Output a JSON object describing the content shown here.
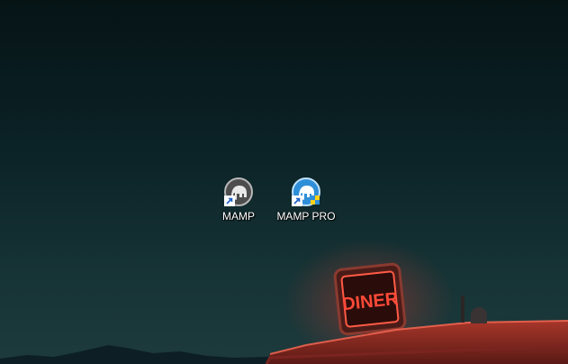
{
  "desktop": {
    "icons": [
      {
        "label": "MAMP",
        "icon": "mamp-elephant-icon"
      },
      {
        "label": "MAMP PRO",
        "icon": "mamp-pro-elephant-icon"
      }
    ],
    "wallpaper": {
      "sign_text": "DINER",
      "colors": {
        "sky_top": "#061416",
        "sky_bottom": "#1d3a3c",
        "neon": "#ff3b2e"
      }
    }
  }
}
